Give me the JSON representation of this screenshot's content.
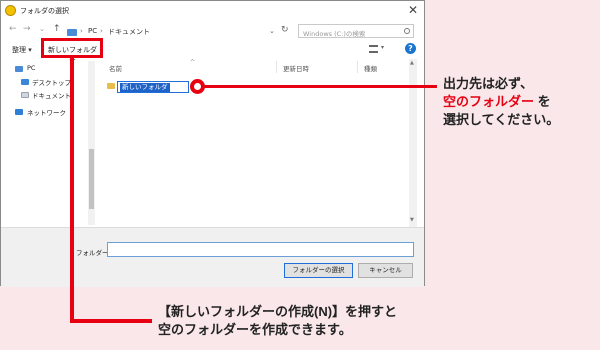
{
  "dialog": {
    "title": "フォルダの選択",
    "close_glyph": "✕",
    "address": {
      "back": "←",
      "forward": "→",
      "history": "⌄",
      "up": "↑",
      "crumbs": [
        "PC",
        "ドキュメント"
      ],
      "sep": "›",
      "dropdown": "⌄",
      "refresh": "↻",
      "search_placeholder": "Windows (C:)の検索"
    },
    "toolbar": {
      "organize": "整理 ▾",
      "new_folder": "新しいフォルダー",
      "view_chevron": "▾",
      "help": "?"
    },
    "nav": [
      "PC",
      "デスクトップ",
      "ドキュメント",
      "ネットワーク"
    ],
    "columns": {
      "name": "名前",
      "modified": "更新日時",
      "type": "種類",
      "sort_arrow": "^"
    },
    "rename_value": "新しいフォルダ",
    "footer": {
      "folder_label": "フォルダー:",
      "folder_value": "",
      "select_button": "フォルダーの選択",
      "cancel_button": "キャンセル"
    }
  },
  "annotation": {
    "right_note_line1": "出力先は必ず、",
    "right_note_red": "空のフォルダー",
    "right_note_tail": " を",
    "right_note_line3": "選択してください。",
    "bottom_note_line1": "【新しいフォルダーの作成(N)】を押すと",
    "bottom_note_line2": "空のフォルダーを作成できます。"
  },
  "colors": {
    "accent_red": "#e60012",
    "background": "#f9e7ea",
    "selection_blue": "#1f63c9"
  }
}
